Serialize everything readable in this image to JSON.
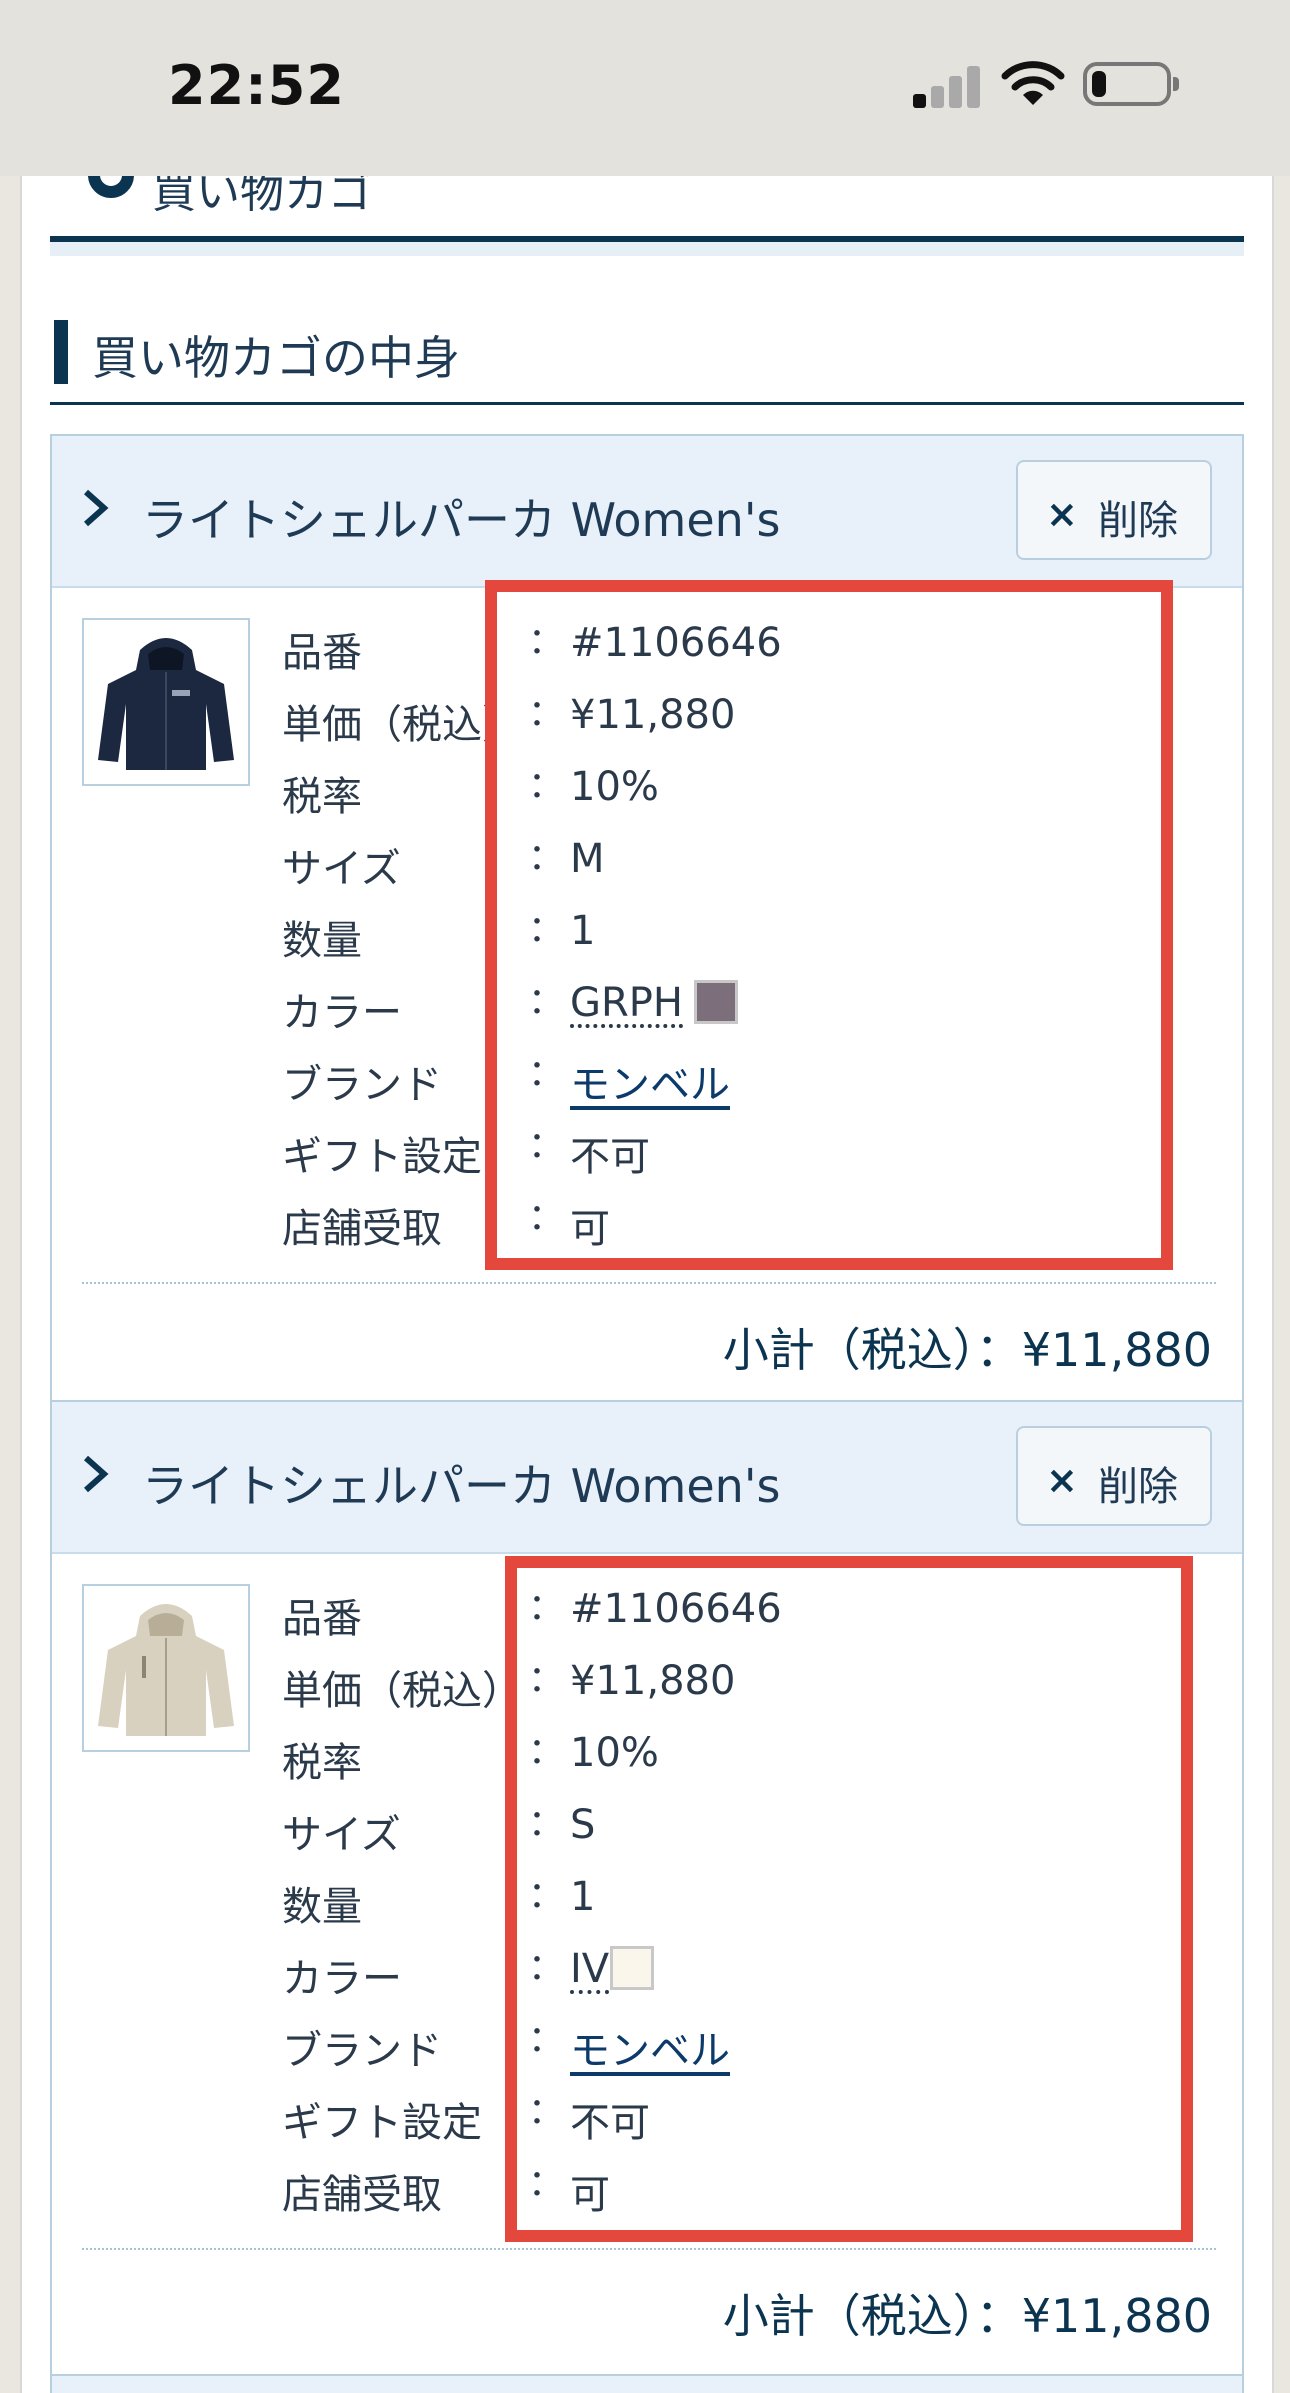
{
  "status_bar": {
    "time": "22:52"
  },
  "page": {
    "cart_heading": "買い物カゴ",
    "section_title": "買い物カゴの中身"
  },
  "labels": {
    "product_number": "品番",
    "unit_price": "単価（税込）",
    "tax_rate": "税率",
    "size": "サイズ",
    "quantity": "数量",
    "color": "カラー",
    "brand": "ブランド",
    "gift": "ギフト設定",
    "store_pickup": "店舗受取",
    "colon": "：",
    "subtotal": "小計（税込）：¥11,880",
    "delete_icon": "×",
    "delete": "削除"
  },
  "items": [
    {
      "title": "ライトシェルパーカ Women's",
      "product_number": "#1106646",
      "unit_price": "¥11,880",
      "tax_rate": "10%",
      "size": "M",
      "quantity": "1",
      "color_code": "GRPH",
      "color_swatch": "#7c6e7a",
      "brand": "モンベル",
      "gift": "不可",
      "store_pickup": "可",
      "jacket_color": "#1c2740"
    },
    {
      "title": "ライトシェルパーカ Women's",
      "product_number": "#1106646",
      "unit_price": "¥11,880",
      "tax_rate": "10%",
      "size": "S",
      "quantity": "1",
      "color_code": "IV",
      "color_swatch": "#faf6ec",
      "brand": "モンベル",
      "gift": "不可",
      "store_pickup": "可",
      "jacket_color": "#d9d1c0"
    }
  ],
  "highlight_color": "#e4483d"
}
